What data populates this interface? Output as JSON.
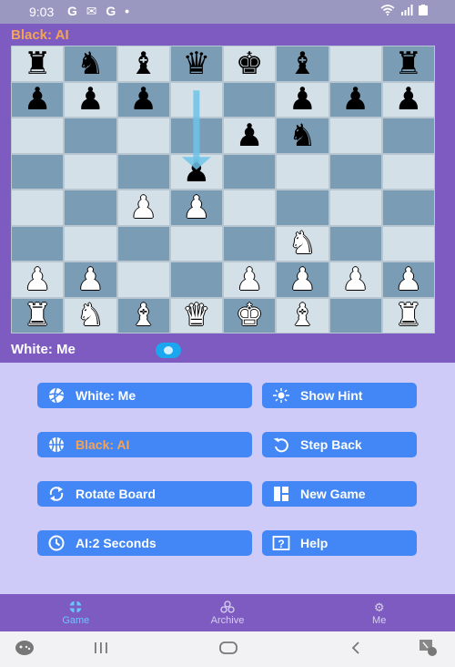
{
  "status_bar": {
    "time": "9:03",
    "notification_icons": [
      "google-icon",
      "gmail-icon",
      "google-icon",
      "dot-icon"
    ],
    "notification_text": "G ✉ G •",
    "system_icons": [
      "wifi-icon",
      "signal-icon",
      "battery-icon"
    ]
  },
  "game": {
    "black_player_label": "Black: AI",
    "white_player_label": "White: Me",
    "turn": "white",
    "board_orientation": "white-bottom",
    "ranks": [
      [
        "r",
        "n",
        "b",
        "q",
        "k",
        "b",
        "",
        "r"
      ],
      [
        "p",
        "p",
        "p",
        "",
        "",
        "p",
        "p",
        "p"
      ],
      [
        "",
        "",
        "",
        "",
        "p",
        "n",
        "",
        ""
      ],
      [
        "",
        "",
        "",
        "p",
        "",
        "",
        "",
        ""
      ],
      [
        "",
        "",
        "P",
        "P",
        "",
        "",
        "",
        ""
      ],
      [
        "",
        "",
        "",
        "",
        "",
        "N",
        "",
        ""
      ],
      [
        "P",
        "P",
        "",
        "",
        "P",
        "P",
        "P",
        "P"
      ],
      [
        "R",
        "N",
        "B",
        "Q",
        "K",
        "B",
        "",
        "R"
      ]
    ],
    "last_move": {
      "from": "d7",
      "to": "d5"
    },
    "colors": {
      "light_square": "#d4e0e8",
      "dark_square": "#7a9db5",
      "arrow": "#6ec3e8",
      "panel": "#7d5bc0",
      "black_label": "#f4a357"
    }
  },
  "controls": {
    "white_player": {
      "label": "White: Me",
      "icon": "volleyball-icon"
    },
    "show_hint": {
      "label": "Show Hint",
      "icon": "hint-light-icon"
    },
    "black_player": {
      "label": "Black: AI",
      "icon": "basketball-icon"
    },
    "step_back": {
      "label": "Step Back",
      "icon": "undo-icon"
    },
    "rotate_board": {
      "label": "Rotate Board",
      "icon": "rotate-icon"
    },
    "new_game": {
      "label": "New Game",
      "icon": "dashboard-icon"
    },
    "ai_time": {
      "label": "AI:2 Seconds",
      "icon": "clock-icon"
    },
    "help": {
      "label": "Help",
      "icon": "help-icon"
    },
    "button_color": "#4287f5"
  },
  "bottom_nav": {
    "items": [
      {
        "label": "Game",
        "icon": "game-icon",
        "active": true
      },
      {
        "label": "Archive",
        "icon": "archive-icon",
        "active": false
      },
      {
        "label": "Me",
        "icon": "gear-icon",
        "active": false
      }
    ]
  },
  "system_nav": {
    "icons": [
      "game-launcher-icon",
      "recent-apps-icon",
      "home-icon",
      "back-icon",
      "screenshot-icon"
    ]
  }
}
